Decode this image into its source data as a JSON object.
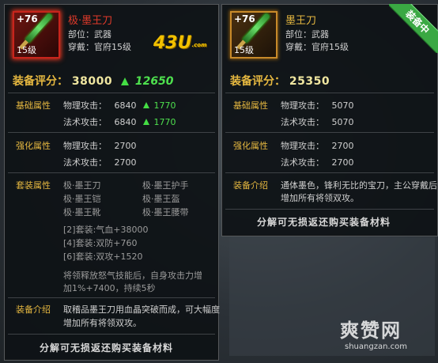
{
  "left": {
    "plus": "+76",
    "level": "15级",
    "name": "极·墨王刀",
    "slot": "部位：武器",
    "requirement": "穿戴：官府15级",
    "score_label": "装备评分：",
    "score_value": "38000",
    "score_delta": "12650",
    "base_title": "基础属性",
    "base_rows": [
      {
        "label": "物理攻击：",
        "value": "6840",
        "delta": "1770"
      },
      {
        "label": "法术攻击：",
        "value": "6840",
        "delta": "1770"
      }
    ],
    "enhance_title": "强化属性",
    "enhance_rows": [
      {
        "label": "物理攻击：",
        "value": "2700"
      },
      {
        "label": "法术攻击：",
        "value": "2700"
      }
    ],
    "set_title": "套装属性",
    "set_items": [
      "极·墨王刀",
      "极·墨王护手",
      "极·墨王铠",
      "极·墨王盔",
      "极·墨王靴",
      "极·墨王腰带"
    ],
    "set_bonuses": [
      "[2]套装:气血+38000",
      "[4]套装:双防+760",
      "[6]套装:双攻+1520"
    ],
    "set_desc_1": "将领释放怒气技能后，自身攻击力增",
    "set_desc_2": "加1%+7400，持续5秒",
    "intro_title": "装备介绍",
    "intro_1": "取稽品墨王刀用血晶突破而成，可大幅度",
    "intro_2": "增加所有将领双攻。",
    "footer": "分解可无损返还购买装备材料"
  },
  "right": {
    "plus": "+76",
    "level": "15级",
    "name": "墨王刀",
    "slot": "部位：武器",
    "requirement": "穿戴：官府15级",
    "equipped_badge": "装备中",
    "score_label": "装备评分：",
    "score_value": "25350",
    "base_title": "基础属性",
    "base_rows": [
      {
        "label": "物理攻击：",
        "value": "5070"
      },
      {
        "label": "法术攻击：",
        "value": "5070"
      }
    ],
    "enhance_title": "强化属性",
    "enhance_rows": [
      {
        "label": "物理攻击：",
        "value": "2700"
      },
      {
        "label": "法术攻击：",
        "value": "2700"
      }
    ],
    "intro_title": "装备介绍",
    "intro_1": "通体墨色，锋利无比的宝刀，主公穿戴后",
    "intro_2": "增加所有将领双攻。",
    "footer": "分解可无损返还购买装备材料"
  },
  "logo": {
    "main": "43U",
    "sub": ".com"
  },
  "watermark": {
    "main": "爽赞网",
    "sub": "shuangzan.com"
  },
  "colors": {
    "gold": "#e6b840",
    "red_name": "#e03a2a",
    "green_up": "#4ee04e",
    "equipped": "#3aa843"
  }
}
